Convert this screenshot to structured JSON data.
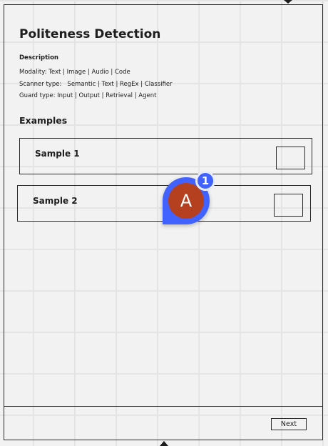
{
  "card": {
    "title": "Politeness Detection",
    "description_label": "Description",
    "modality": "Modality: Text | Image | Audio | Code",
    "scanner_type": "Scanner type:   Semantic | Text | RegEx | Classifier",
    "guard_type": "Guard type: Input | Output | Retrieval | Agent",
    "examples_heading": "Examples",
    "samples": [
      {
        "label": "Sample 1"
      },
      {
        "label": "Sample 2"
      }
    ],
    "next_label": "Next"
  },
  "collaborator": {
    "initial": "A",
    "count": "1",
    "avatar_color": "#b5401f",
    "accent_color": "#4262ff"
  }
}
